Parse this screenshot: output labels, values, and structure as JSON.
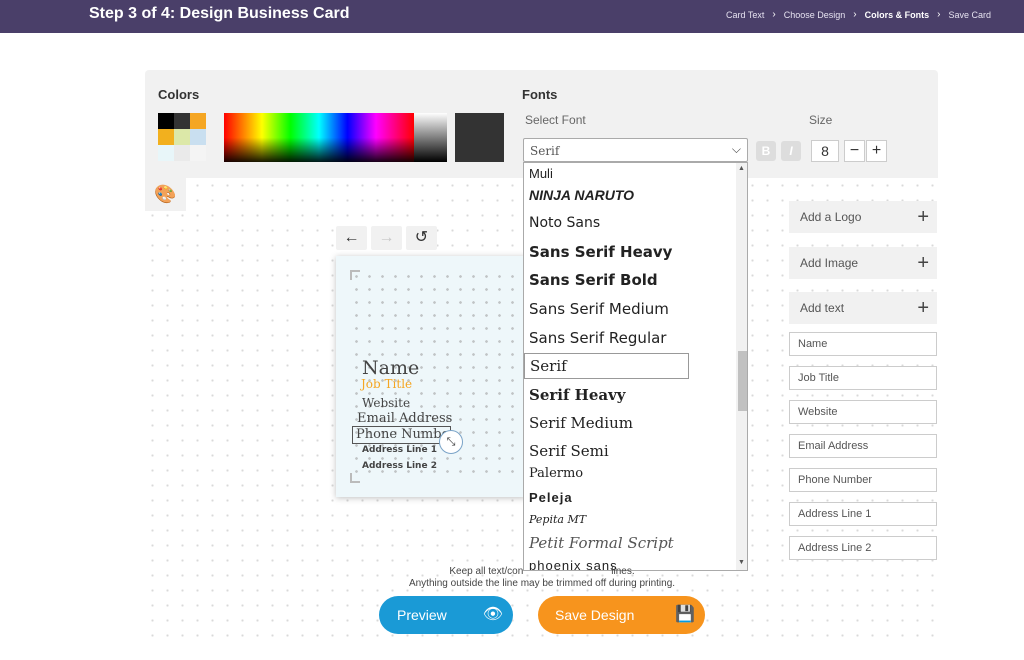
{
  "header": {
    "title": "Step 3 of 4: Design Business Card",
    "breadcrumbs": [
      "Card Text",
      "Choose Design",
      "Colors & Fonts",
      "Save Card"
    ],
    "active_index": 2
  },
  "colors": {
    "label": "Colors",
    "swatches": [
      "#000000",
      "#333333",
      "#f5a623",
      "#f2b01e",
      "#dce8a8",
      "#c9dff0",
      "#e8f6f9",
      "#eaeaea",
      "#f4f4f4"
    ],
    "current": "#333333"
  },
  "fonts": {
    "label": "Fonts",
    "select_label": "Select Font",
    "selected": "Serif",
    "size_label": "Size",
    "size": "8",
    "bold": "B",
    "italic": "I",
    "minus": "−",
    "plus": "+",
    "options": [
      "Muli",
      "NINJA NARUTO",
      "Noto Sans",
      "Sans Serif Heavy",
      "Sans Serif Bold",
      "Sans Serif Medium",
      "Sans Serif Regular",
      "Serif",
      "Serif Heavy",
      "Serif Medium",
      "Serif Semi",
      "Palermo",
      "Peleja",
      "Pepita MT",
      "Petit Formal Script",
      "phoenix sans"
    ]
  },
  "card": {
    "name": "Name",
    "job_title": "Job Title",
    "website": "Website",
    "email": "Email Address",
    "phone": "Phone Number",
    "address1": "Address Line 1",
    "address2": "Address Line 2"
  },
  "sidebar": {
    "buttons": [
      "Add a Logo",
      "Add Image",
      "Add text"
    ],
    "fields": [
      "Name",
      "Job Title",
      "Website",
      "Email Address",
      "Phone Number",
      "Address Line 1",
      "Address Line 2"
    ]
  },
  "footer": {
    "note_line1": "Keep all text/con",
    "note_line1_tail": "lines.",
    "note_line2": "Anything outside the line may be trimmed off during printing.",
    "preview": "Preview",
    "save": "Save Design"
  },
  "icons": {
    "palette": "palette-icon",
    "undo": "undo-icon",
    "redo": "redo-icon",
    "reset": "reset-icon",
    "eye": "eye-icon",
    "floppy": "floppy-icon"
  },
  "accent": {
    "header": "#4a3f69",
    "preview": "#1a9ad6",
    "save": "#f7941d",
    "job_title": "#f5a623"
  }
}
